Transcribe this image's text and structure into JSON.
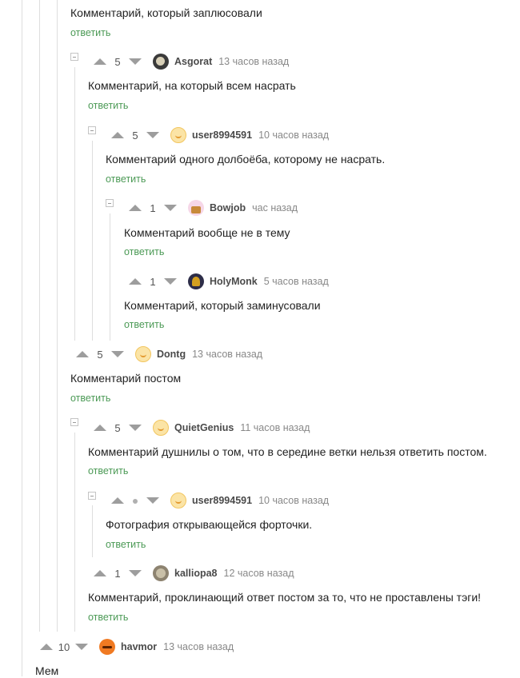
{
  "comments": [
    {
      "text": "Комментарий, который заплюсовали",
      "reply": "ответить"
    },
    {
      "rating": "5",
      "user": "Asgorat",
      "time": "13 часов назад",
      "text": "Комментарий, на который всем насрать",
      "reply": "ответить",
      "avatar": "asgorat-avatar"
    },
    {
      "rating": "5",
      "user": "user8994591",
      "time": "10 часов назад",
      "text": "Комментарий одного долбоёба, которому не насрать.",
      "reply": "ответить",
      "avatar": "default-avatar"
    },
    {
      "rating": "1",
      "user": "Bowjob",
      "time": "час назад",
      "text": "Комментарий вообще не в тему",
      "reply": "ответить",
      "avatar": "cupcake-avatar"
    },
    {
      "rating": "1",
      "user": "HolyMonk",
      "time": "5 часов назад",
      "text": "Комментарий, который заминусовали",
      "reply": "ответить",
      "avatar": "monk-avatar"
    },
    {
      "rating": "5",
      "user": "Dontg",
      "time": "13 часов назад",
      "text": "Комментарий постом",
      "reply": "ответить",
      "avatar": "default-avatar"
    },
    {
      "rating": "5",
      "user": "QuietGenius",
      "time": "11 часов назад",
      "text": "Комментарий душнилы о том, что в середине ветки нельзя ответить постом.",
      "reply": "ответить",
      "avatar": "default-avatar"
    },
    {
      "rating": "",
      "user": "user8994591",
      "time": "10 часов назад",
      "text": "Фотография открывающейся форточки.",
      "reply": "ответить",
      "avatar": "default-avatar"
    },
    {
      "rating": "1",
      "user": "kalliopa8",
      "time": "12 часов назад",
      "text": "Комментарий, проклинающий ответ постом за то, что не проставлены тэги!",
      "reply": "ответить",
      "avatar": "kalliopa-avatar"
    },
    {
      "rating": "10",
      "user": "havmor",
      "time": "13 часов назад",
      "text": "Мем",
      "avatar": "orange-avatar"
    }
  ],
  "colors": {
    "reply_link": "#4c9a56",
    "thread_line": "#dedede",
    "vote_arrow": "#9d9d9d"
  }
}
